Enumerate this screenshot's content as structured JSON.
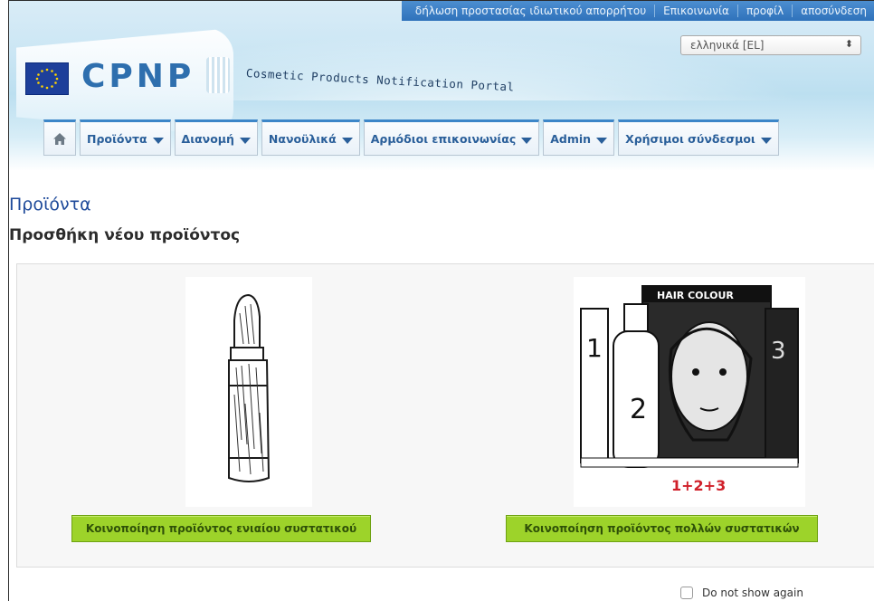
{
  "header": {
    "logo_text": "CPNP",
    "tagline": "Cosmetic Products Notification Portal",
    "eu_flag_icon": "eu-flag-icon"
  },
  "toplinks": [
    "δήλωση προστασίας ιδιωτικού απορρήτου",
    "Επικοινωνία",
    "προφίλ",
    "αποσύνδεση"
  ],
  "language": {
    "selected": "ελληνικά [EL]",
    "arrow_icon": "updown-arrows-icon"
  },
  "nav": {
    "home_icon": "home-icon",
    "items": [
      "Προϊόντα",
      "Διανομή",
      "Νανοϋλικά",
      "Αρμόδιοι επικοινωνίας",
      "Admin",
      "Χρήσιμοι σύνδεσμοι"
    ]
  },
  "page": {
    "title": "Προϊόντα",
    "subtitle": "Προσθήκη νέου προϊόντος"
  },
  "products": {
    "single": {
      "button": "Κοινοποίηση προϊόντος ενιαίου συστατικού",
      "image": "lipstick-illustration"
    },
    "multi": {
      "button": "Κοινοποίηση προϊόντος πολλών συστατικών",
      "image": "hair-colour-kit-illustration",
      "box_label": "HAIR COLOUR",
      "kit_label": "1+2+3"
    }
  },
  "footer": {
    "dont_show_label": "Do not show again"
  },
  "colors": {
    "accent_blue": "#2f72bb",
    "button_green": "#9dd32a",
    "title_blue": "#1e4a9a"
  }
}
